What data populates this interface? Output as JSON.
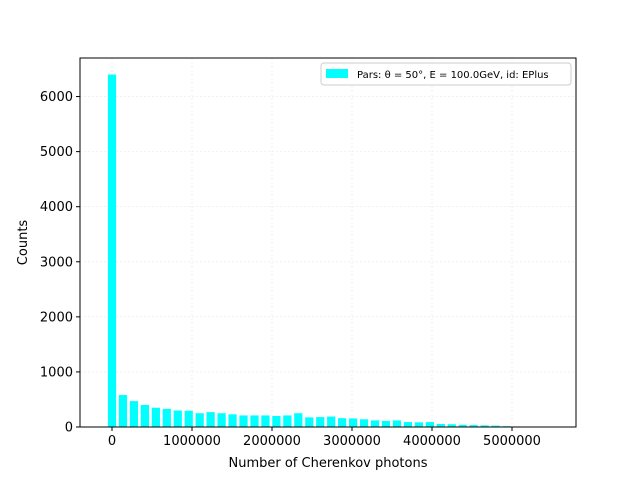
{
  "chart_data": {
    "type": "bar",
    "xlabel": "Number of Cherenkov photons",
    "ylabel": "Counts",
    "xlim": [
      -400000,
      5800000
    ],
    "ylim": [
      0,
      6700
    ],
    "xticks": [
      0,
      1000000,
      2000000,
      3000000,
      4000000,
      5000000
    ],
    "xtick_labels": [
      "0",
      "1000000",
      "2000000",
      "3000000",
      "4000000",
      "5000000"
    ],
    "yticks": [
      0,
      1000,
      2000,
      3000,
      4000,
      5000,
      6000
    ],
    "ytick_labels": [
      "0",
      "1000",
      "2000",
      "3000",
      "4000",
      "5000",
      "6000"
    ],
    "grid": true,
    "legend_position": "top-right",
    "bar_color": "#00ffff",
    "bin_width": 137000,
    "bar_width_fraction": 0.75,
    "series": [
      {
        "name": "Pars: θ = 50°, E = 100.0GeV, id: EPlus",
        "x": [
          0,
          137000,
          274000,
          411000,
          548000,
          685000,
          822000,
          959000,
          1096000,
          1233000,
          1370000,
          1507000,
          1644000,
          1781000,
          1918000,
          2055000,
          2192000,
          2329000,
          2466000,
          2603000,
          2740000,
          2877000,
          3014000,
          3151000,
          3288000,
          3425000,
          3562000,
          3699000,
          3836000,
          3973000,
          4110000,
          4247000,
          4384000,
          4521000,
          4658000,
          4795000,
          4932000,
          5069000,
          5206000,
          5343000
        ],
        "values": [
          6400,
          580,
          470,
          400,
          350,
          330,
          300,
          295,
          250,
          270,
          250,
          230,
          210,
          210,
          210,
          200,
          210,
          250,
          175,
          180,
          190,
          160,
          155,
          140,
          120,
          110,
          120,
          90,
          85,
          90,
          55,
          50,
          40,
          35,
          30,
          25,
          15,
          10,
          8,
          5
        ]
      }
    ]
  }
}
